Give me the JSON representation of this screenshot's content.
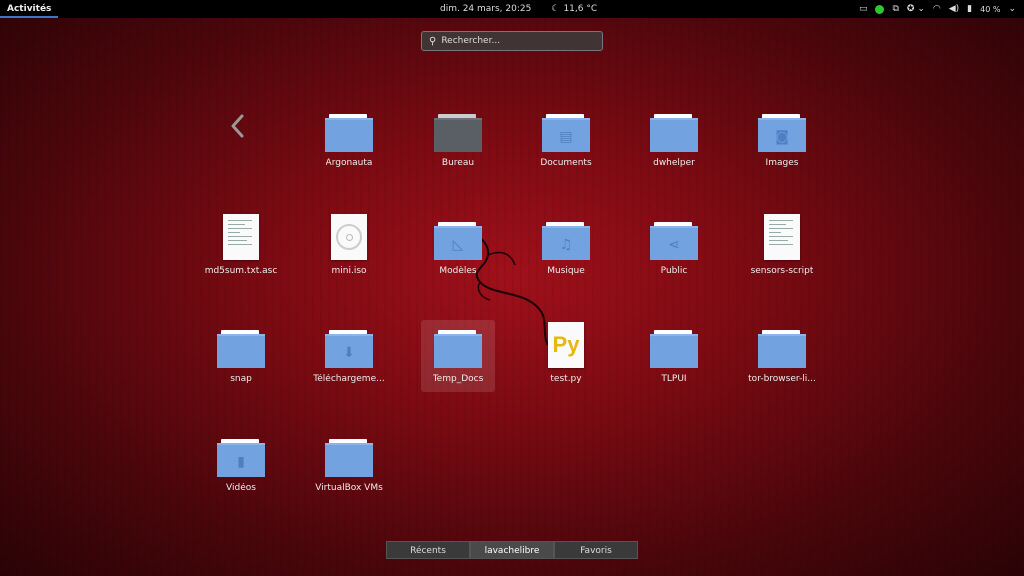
{
  "topbar": {
    "activities": "Activités",
    "datetime": "dim. 24 mars, 20:25",
    "weather": "11,6 °C",
    "battery": "40 %"
  },
  "search": {
    "placeholder": "Rechercher..."
  },
  "items": [
    {
      "label": "Argonauta",
      "kind": "folder",
      "icon": "folder-icon"
    },
    {
      "label": "Bureau",
      "kind": "desktop",
      "icon": "desktop-folder-icon"
    },
    {
      "label": "Documents",
      "kind": "folder",
      "icon": "documents-folder-icon"
    },
    {
      "label": "dwhelper",
      "kind": "folder",
      "icon": "folder-icon"
    },
    {
      "label": "Images",
      "kind": "folder",
      "icon": "pictures-folder-icon"
    },
    {
      "label": "md5sum.txt.asc",
      "kind": "doc",
      "icon": "text-file-icon"
    },
    {
      "label": "mini.iso",
      "kind": "iso",
      "icon": "disc-image-icon"
    },
    {
      "label": "Modèles",
      "kind": "folder",
      "icon": "templates-folder-icon"
    },
    {
      "label": "Musique",
      "kind": "folder",
      "icon": "music-folder-icon"
    },
    {
      "label": "Public",
      "kind": "folder",
      "icon": "public-folder-icon"
    },
    {
      "label": "sensors-script",
      "kind": "doc",
      "icon": "script-file-icon"
    },
    {
      "label": "snap",
      "kind": "folder",
      "icon": "folder-icon"
    },
    {
      "label": "Téléchargeme...",
      "kind": "folder",
      "icon": "downloads-folder-icon"
    },
    {
      "label": "Temp_Docs",
      "kind": "folder",
      "icon": "folder-icon"
    },
    {
      "label": "test.py",
      "kind": "py",
      "icon": "python-file-icon"
    },
    {
      "label": "TLPUI",
      "kind": "folder",
      "icon": "folder-icon"
    },
    {
      "label": "tor-browser-li...",
      "kind": "folder",
      "icon": "folder-icon"
    },
    {
      "label": "Vidéos",
      "kind": "folder",
      "icon": "videos-folder-icon"
    },
    {
      "label": "VirtualBox VMs",
      "kind": "folder",
      "icon": "folder-icon"
    }
  ],
  "tabs": [
    {
      "label": "Récents"
    },
    {
      "label": "lavachelibre"
    },
    {
      "label": "Favoris"
    }
  ]
}
